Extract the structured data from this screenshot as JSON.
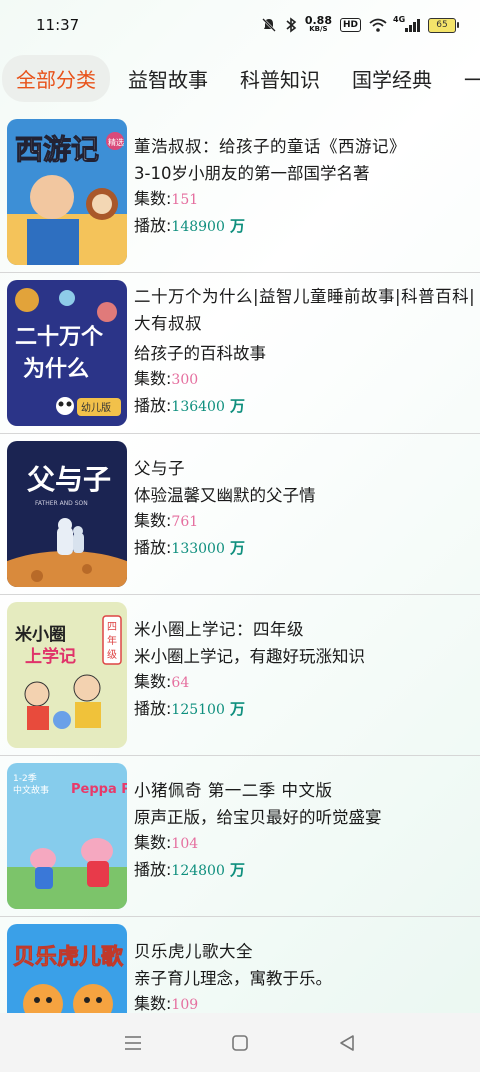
{
  "status": {
    "time": "11:37",
    "speed_value": "0.88",
    "speed_unit": "KB/S",
    "hd": "HD",
    "signal_label": "4G",
    "battery": "65",
    "icons": [
      "mute-bell-icon",
      "bluetooth-icon",
      "wifi-icon",
      "signal-icon",
      "battery-icon"
    ]
  },
  "tabs": [
    {
      "label": "全部分类",
      "active": true
    },
    {
      "label": "益智故事",
      "active": false
    },
    {
      "label": "科普知识",
      "active": false
    },
    {
      "label": "国学经典",
      "active": false
    },
    {
      "label": "一",
      "active": false
    }
  ],
  "labels": {
    "episodes": "集数:",
    "plays": "播放:",
    "plays_unit": "万"
  },
  "items": [
    {
      "title": "董浩叔叔：给孩子的童话《西游记》",
      "subtitle": "3-10岁小朋友的第一部国学名著",
      "episodes": "151",
      "plays": "148900",
      "cover": {
        "text": "西游记",
        "badge": "精选",
        "bg": "#2a7fc6"
      }
    },
    {
      "title": "二十万个为什么|益智儿童睡前故事|科普百科|大有叔叔",
      "subtitle": "给孩子的百科故事",
      "episodes": "300",
      "plays": "136400",
      "cover": {
        "text": "二十万个为什么",
        "badge": "幼儿版",
        "bg": "#2d3a8c"
      }
    },
    {
      "title": "父与子",
      "subtitle": "体验温馨又幽默的父子情",
      "episodes": "761",
      "plays": "133000",
      "cover": {
        "text": "父与子",
        "sub": "FATHER AND SON",
        "bg": "#1c2756"
      }
    },
    {
      "title": "米小圈上学记：四年级",
      "subtitle": "米小圈上学记，有趣好玩涨知识",
      "episodes": "64",
      "plays": "125100",
      "cover": {
        "text": "米小圈上学记",
        "badge": "四年级",
        "bg": "#f5f0dc"
      }
    },
    {
      "title": "小猪佩奇 第一二季 中文版",
      "subtitle": "原声正版，给宝贝最好的听觉盛宴",
      "episodes": "104",
      "plays": "124800",
      "cover": {
        "text": "Peppa Pig",
        "badge": "1-2季 中文故事",
        "bg": "#7ec8ea"
      }
    },
    {
      "title": "贝乐虎儿歌大全",
      "subtitle": "亲子育儿理念，寓教于乐。",
      "episodes": "109",
      "plays": "",
      "cover": {
        "text": "贝乐虎儿歌",
        "bg": "#3aa0e8"
      }
    }
  ],
  "colors": {
    "active_tab": "#e8521a",
    "episodes": "#e56f9f",
    "plays": "#0f8f7e"
  }
}
